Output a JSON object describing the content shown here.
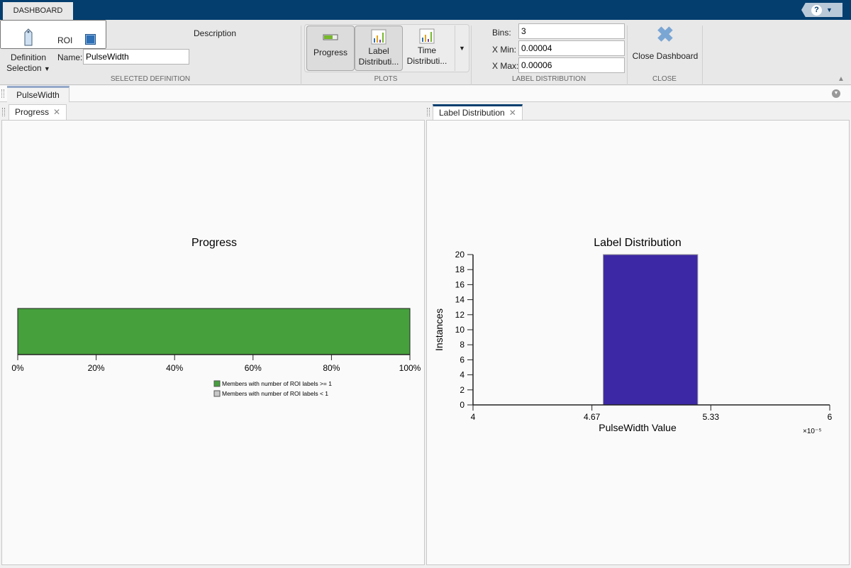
{
  "toolstrip": {
    "tab": "DASHBOARD",
    "help": "?"
  },
  "selected_definition": {
    "definition_selection": [
      "Definition",
      "Selection"
    ],
    "roi_label": "ROI",
    "name_label": "Name:",
    "name_value": "PulseWidth",
    "description_label": "Description",
    "description_value": "",
    "section": "SELECTED DEFINITION"
  },
  "plots": {
    "buttons": [
      {
        "label": [
          "Progress"
        ],
        "selected": true
      },
      {
        "label": [
          "Label",
          "Distributi..."
        ],
        "selected": true
      },
      {
        "label": [
          "Time",
          "Distributi..."
        ],
        "selected": false
      }
    ],
    "section": "PLOTS"
  },
  "label_distribution": {
    "bins_label": "Bins:",
    "bins": "3",
    "xmin_label": "X Min:",
    "xmin": "0.00004",
    "xmax_label": "X Max:",
    "xmax": "0.00006",
    "section": "LABEL DISTRIBUTION"
  },
  "close": {
    "label": "Close Dashboard",
    "section": "CLOSE"
  },
  "document_tab": "PulseWidth",
  "panels": {
    "left_tab": "Progress",
    "right_tab": "Label Distribution"
  },
  "colors": {
    "progress_green": "#46a03c",
    "hist_bar": "#3c28a5",
    "accent": "#033e6f"
  },
  "chart_data": [
    {
      "type": "bar",
      "title": "Progress",
      "orientation": "horizontal",
      "xlim": [
        0,
        100
      ],
      "xticks": [
        "0%",
        "20%",
        "40%",
        "60%",
        "80%",
        "100%"
      ],
      "series": [
        {
          "name": "Members with number of ROI labels >= 1",
          "value": 100,
          "color": "#46a03c"
        },
        {
          "name": "Members with number of ROI labels < 1",
          "value": 0,
          "color": "#c8c8c8"
        }
      ],
      "legend": "bottom-right"
    },
    {
      "type": "bar",
      "title": "Label Distribution",
      "xlabel": "PulseWidth Value",
      "ylabel": "Instances",
      "x_multiplier": "×10⁻⁵",
      "xlim": [
        4,
        6
      ],
      "ylim": [
        0,
        20
      ],
      "xticks": [
        "4",
        "4.67",
        "5.33",
        "6"
      ],
      "yticks": [
        "0",
        "2",
        "4",
        "6",
        "8",
        "10",
        "12",
        "14",
        "16",
        "18",
        "20"
      ],
      "bins": [
        {
          "x0": 4.73,
          "x1": 5.26,
          "value": 20
        }
      ]
    }
  ]
}
